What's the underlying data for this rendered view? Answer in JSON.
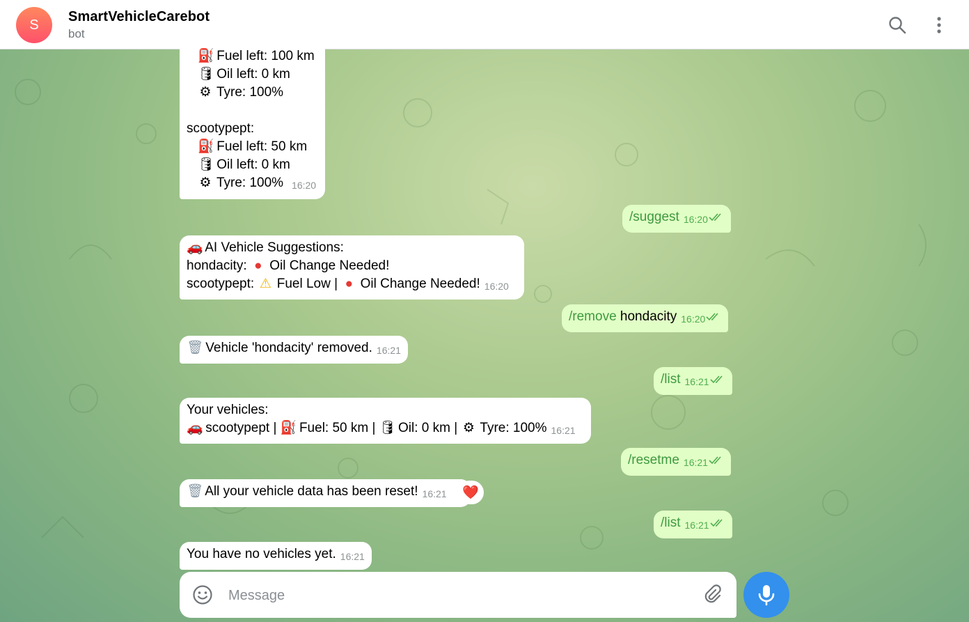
{
  "header": {
    "avatar_letter": "S",
    "title": "SmartVehicleCarebot",
    "subtitle": "bot",
    "accent": "#3390ec"
  },
  "messages": {
    "m1": {
      "lines": [
        "Fuel left: 100 km",
        "Oil left: 0 km",
        "Tyre: 100%",
        "",
        "scootypept:",
        "Fuel left: 50 km",
        "Oil left: 0 km",
        "Tyre: 100%"
      ],
      "time": "16:20"
    },
    "m2": {
      "cmd": "/suggest",
      "time": "16:20"
    },
    "m3": {
      "line1": "AI Vehicle Suggestions:",
      "line2a": "hondacity:",
      "line2b": "Oil Change Needed!",
      "line3a": "scootypept:",
      "line3b": "Fuel Low |",
      "line3c": "Oil Change Needed!",
      "time": "16:20"
    },
    "m4": {
      "cmd": "/remove",
      "arg": "hondacity",
      "time": "16:20"
    },
    "m5": {
      "text": "Vehicle 'hondacity' removed.",
      "time": "16:21"
    },
    "m6": {
      "cmd": "/list",
      "time": "16:21"
    },
    "m7": {
      "line1": "Your vehicles:",
      "line2a": "scootypept |",
      "line2b": "Fuel: 50 km |",
      "line2c": "Oil: 0 km |",
      "line2d": "Tyre: 100%",
      "time": "16:21"
    },
    "m8": {
      "cmd": "/resetme",
      "time": "16:21"
    },
    "m9": {
      "text": "All your vehicle data has been reset!",
      "time": "16:21",
      "reaction": "❤️"
    },
    "m10": {
      "cmd": "/list",
      "time": "16:21"
    },
    "m11": {
      "text": "You have no vehicles yet.",
      "time": "16:21"
    }
  },
  "composer": {
    "placeholder": "Message"
  },
  "icons": {
    "fuel": "fuel-pump-icon",
    "oil": "oil-drum-icon",
    "tyre": "tyre-icon",
    "car": "car-icon",
    "red_circle": "red-circle-icon",
    "warning": "warning-icon",
    "trash": "wastebasket-icon",
    "heart": "heart-icon"
  }
}
